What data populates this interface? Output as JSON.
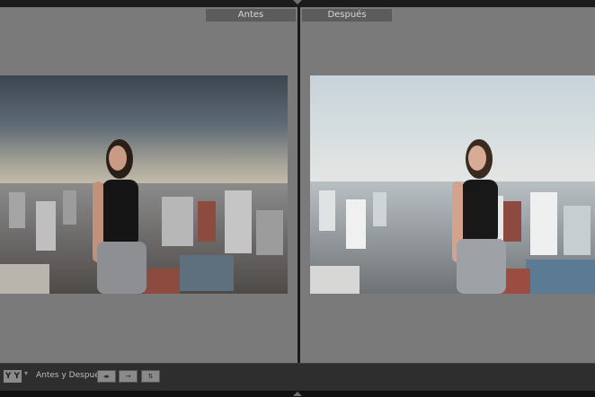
{
  "panes": {
    "before_label": "Antes",
    "after_label": "Después"
  },
  "toolbar": {
    "view_mode_label": "Y Y",
    "caret": "▾",
    "before_after_label": "Antes y Después:",
    "swap_left_right": "◂▸",
    "copy_to_right": "→",
    "swap_vertical": "⇅"
  },
  "colors": {
    "panel_bg": "#7a7a7a",
    "toolbar_bg": "#2e2e2e"
  },
  "icons": [
    "chevron-down-icon",
    "chevron-up-icon"
  ]
}
